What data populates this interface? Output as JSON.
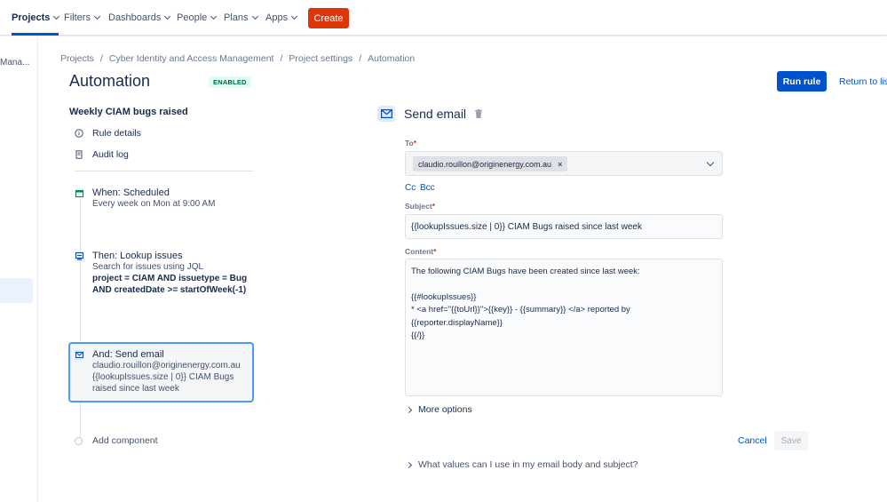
{
  "nav": {
    "items": [
      {
        "label": "Projects",
        "active": true
      },
      {
        "label": "Filters"
      },
      {
        "label": "Dashboards"
      },
      {
        "label": "People"
      },
      {
        "label": "Plans"
      },
      {
        "label": "Apps"
      }
    ],
    "create_label": "Create"
  },
  "sidebar": {
    "label": "Mana..."
  },
  "breadcrumb": [
    "Projects",
    "Cyber Identity and Access Management",
    "Project settings",
    "Automation"
  ],
  "page": {
    "title": "Automation",
    "status_badge": "ENABLED",
    "run_rule_label": "Run rule",
    "return_label": "Return to list"
  },
  "rule": {
    "name": "Weekly CIAM bugs raised",
    "links": [
      {
        "label": "Rule details",
        "icon": "info-icon"
      },
      {
        "label": "Audit log",
        "icon": "document-icon"
      }
    ],
    "components": [
      {
        "title": "When: Scheduled",
        "icon": "calendar-icon",
        "desc": "Every week on Mon at 9:00 AM"
      },
      {
        "title": "Then: Lookup issues",
        "icon": "lookup-icon",
        "desc": "Search for issues using JQL",
        "jql": "project = CIAM AND issuetype = Bug AND createdDate >= startOfWeek(-1)"
      },
      {
        "title": "And: Send email",
        "icon": "email-icon",
        "desc": "claudio.rouillon@originenergy.com.au",
        "desc2": "{{lookupIssues.size | 0}} CIAM Bugs raised since last week"
      }
    ],
    "add_component_label": "Add component"
  },
  "email": {
    "title": "Send email",
    "to_label": "To",
    "to_value": "claudio.rouillon@originenergy.com.au",
    "cc_label": "Cc",
    "bcc_label": "Bcc",
    "subject_label": "Subject",
    "subject_value": "{{lookupIssues.size | 0}} CIAM Bugs raised since last week",
    "content_label": "Content",
    "content_lines": [
      "The following CIAM Bugs have been created since last week:",
      "",
      "{{#lookupIssues}}",
      "* <a href=\"{{toUrl}}\">{{key}} - {{summary}} </a> reported by",
      "{{reporter.displayName}}",
      "{{/}}"
    ],
    "more_options_label": "More options",
    "cancel_label": "Cancel",
    "save_label": "Save",
    "help_label": "What values can I use in my email body and subject?"
  },
  "colors": {
    "primary": "#0052cc",
    "create": "#de350b",
    "enabled_bg": "#e3fcef",
    "enabled_text": "#006644",
    "selected_border": "#4c9aff"
  }
}
